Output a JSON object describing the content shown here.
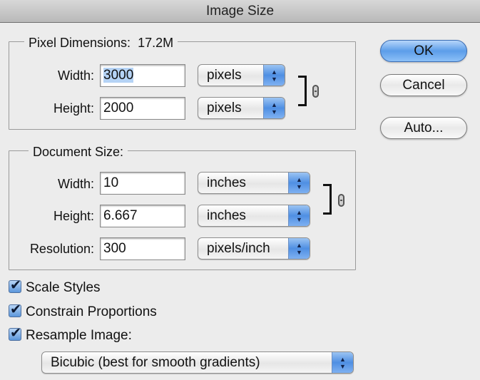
{
  "window": {
    "title": "Image Size"
  },
  "pixel_dimensions": {
    "legend_label": "Pixel Dimensions:",
    "legend_value": "17.2M",
    "width": {
      "label": "Width:",
      "value": "3000",
      "unit": "pixels"
    },
    "height": {
      "label": "Height:",
      "value": "2000",
      "unit": "pixels"
    },
    "link_icon": "chain-link-icon"
  },
  "document_size": {
    "legend_label": "Document Size:",
    "width": {
      "label": "Width:",
      "value": "10",
      "unit": "inches"
    },
    "height": {
      "label": "Height:",
      "value": "6.667",
      "unit": "inches"
    },
    "resolution": {
      "label": "Resolution:",
      "value": "300",
      "unit": "pixels/inch"
    },
    "link_icon": "chain-link-icon"
  },
  "buttons": {
    "ok": "OK",
    "cancel": "Cancel",
    "auto": "Auto..."
  },
  "options": {
    "scale_styles": {
      "label": "Scale Styles",
      "checked": true
    },
    "constrain_proportions": {
      "label": "Constrain Proportions",
      "checked": true
    },
    "resample_image": {
      "label": "Resample Image:",
      "checked": true
    }
  },
  "resample_method": {
    "value": "Bicubic (best for smooth gradients)"
  },
  "colors": {
    "accent": "#5c9de9",
    "selection": "#b5d3f5",
    "background": "#ececec"
  }
}
